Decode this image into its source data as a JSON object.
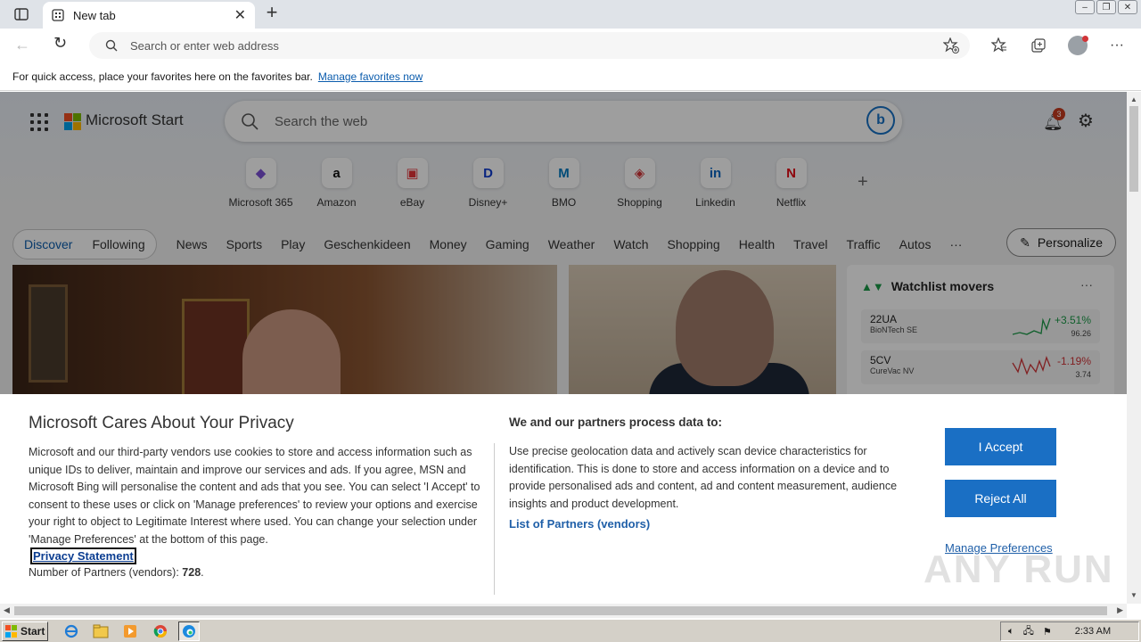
{
  "browser": {
    "tab_title": "New tab",
    "address_placeholder": "Search or enter web address",
    "favbar_text": "For quick access, place your favorites here on the favorites bar.",
    "favbar_link": "Manage favorites now"
  },
  "msn": {
    "brand": "Microsoft Start",
    "search_placeholder": "Search the web",
    "notification_count": "3",
    "quicklinks": [
      {
        "label": "Microsoft 365",
        "glyph": "◆",
        "color": "#7b4fd6"
      },
      {
        "label": "Amazon",
        "glyph": "a",
        "color": "#111111"
      },
      {
        "label": "eBay",
        "glyph": "▣",
        "color": "#e53238"
      },
      {
        "label": "Disney+",
        "glyph": "D",
        "color": "#113ccf"
      },
      {
        "label": "BMO",
        "glyph": "M",
        "color": "#0079c1"
      },
      {
        "label": "Shopping",
        "glyph": "◈",
        "color": "#d13438"
      },
      {
        "label": "Linkedin",
        "glyph": "in",
        "color": "#0a66c2"
      },
      {
        "label": "Netflix",
        "glyph": "N",
        "color": "#e50914"
      }
    ],
    "nav_pill": [
      "Discover",
      "Following"
    ],
    "nav_items": [
      "News",
      "Sports",
      "Play",
      "Geschenkideen",
      "Money",
      "Gaming",
      "Weather",
      "Watch",
      "Shopping",
      "Health",
      "Travel",
      "Traffic",
      "Autos",
      "···"
    ],
    "personalize": "Personalize",
    "watchlist": {
      "title": "Watchlist movers",
      "rows": [
        {
          "symbol": "22UA",
          "name": "BioNTech SE",
          "change": "+3.51%",
          "price": "96.26",
          "color": "#1b9a48"
        },
        {
          "symbol": "5CV",
          "name": "CureVac NV",
          "change": "-1.19%",
          "price": "3.74",
          "color": "#d13438"
        }
      ]
    }
  },
  "privacy": {
    "title": "Microsoft Cares About Your Privacy",
    "body": "Microsoft and our third-party vendors use cookies to store and access information such as unique IDs to deliver, maintain and improve our services and ads. If you agree, MSN and Microsoft Bing will personalise the content and ads that you see. You can select 'I Accept' to consent to these uses or click on 'Manage preferences' to review your options and exercise your right to object to Legitimate Interest where used.  You can change your selection under 'Manage Preferences' at the bottom of this page.",
    "statement_link": "Privacy Statement",
    "partners_label": "Number of Partners (vendors):",
    "partners_count": "728",
    "partners_suffix": ".",
    "heading2": "We and our partners process data to:",
    "body2": "Use precise geolocation data and actively scan device characteristics for identification. This is done to store and access information on a device and to provide personalised ads and content, ad and content measurement, audience insights and product development.",
    "vendors_link": "List of Partners (vendors)",
    "accept": "I Accept",
    "reject": "Reject All",
    "manage": "Manage Preferences"
  },
  "watermark": "ANY RUN",
  "taskbar": {
    "start": "Start",
    "time": "2:33 AM"
  }
}
